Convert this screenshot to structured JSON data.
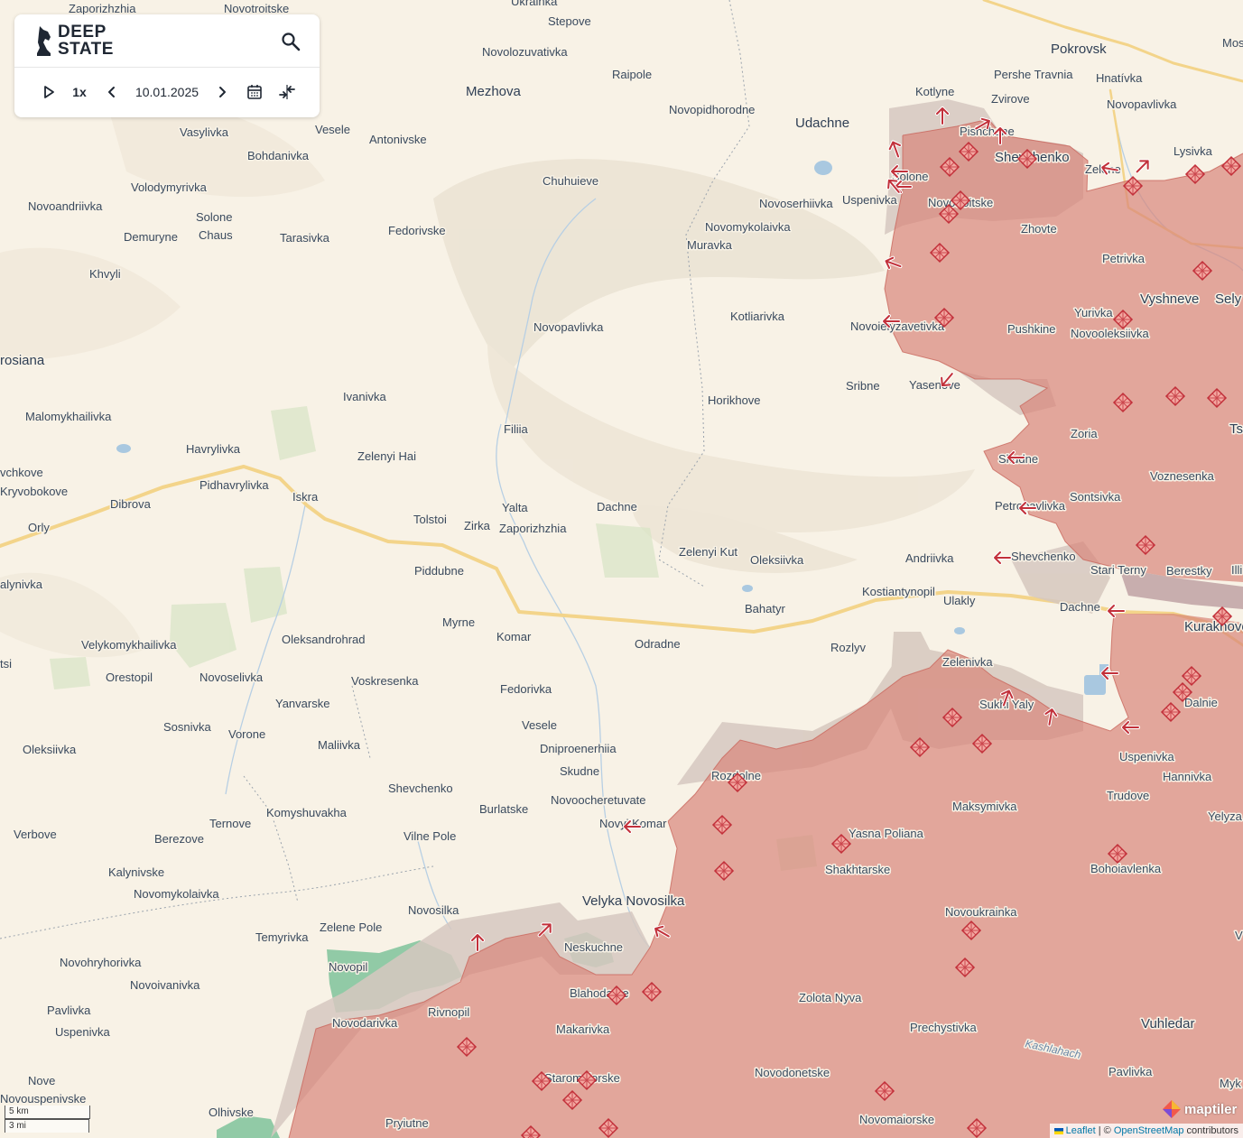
{
  "app": {
    "logo_line1": "DEEP",
    "logo_line2": "STATE",
    "search_icon": "search-icon",
    "play_icon": "play-icon",
    "speed": "1x",
    "date": "10.01.2025",
    "calendar_icon": "calendar-icon",
    "compare_icon": "compare-icon"
  },
  "scale": {
    "km": "5 km",
    "mi": "3 mi"
  },
  "attribution": {
    "leaflet": "Leaflet",
    "separator": " | © ",
    "osm": "OpenStreetMap",
    "suffix": " contributors",
    "maptiler": "maptiler"
  },
  "colors": {
    "occupied": "#d9867a",
    "occupied_opacity": 0.7,
    "contested": "#d6c8bf",
    "liberated": "#7fc39a",
    "background": "#f8f2e6",
    "road": "#f3d48a",
    "marker": "#c2303a"
  },
  "places": [
    {
      "name": "Zaporizhzhia"
    },
    {
      "name": "Novotroitske"
    },
    {
      "name": "Ukrainka"
    },
    {
      "name": "Stepove"
    },
    {
      "name": "Novolozuvativka"
    },
    {
      "name": "Raipole"
    },
    {
      "name": "Mezhova"
    },
    {
      "name": "Novopidhorodne"
    },
    {
      "name": "Udachne"
    },
    {
      "name": "Kotlyne"
    },
    {
      "name": "Pokrovsk"
    },
    {
      "name": "Pershe Travnia"
    },
    {
      "name": "Hnatívka"
    },
    {
      "name": "Zvirove"
    },
    {
      "name": "Novopavlivka"
    },
    {
      "name": "Mos"
    },
    {
      "name": "Pishchane"
    },
    {
      "name": "Shevchenko"
    },
    {
      "name": "Zelene"
    },
    {
      "name": "Lysivka"
    },
    {
      "name": "Solone"
    },
    {
      "name": "Uspenivka"
    },
    {
      "name": "Novotroitske"
    },
    {
      "name": "Zhovte"
    },
    {
      "name": "Petrivka"
    },
    {
      "name": "Vyshneve"
    },
    {
      "name": "Sely"
    },
    {
      "name": "Yurivka"
    },
    {
      "name": "Novooleksiivka"
    },
    {
      "name": "Pushkine"
    },
    {
      "name": "Vasylivka"
    },
    {
      "name": "Vesele"
    },
    {
      "name": "Antonivske"
    },
    {
      "name": "Bohdanivka"
    },
    {
      "name": "Volodymyrivka"
    },
    {
      "name": "Novoandriivka"
    },
    {
      "name": "Solone"
    },
    {
      "name": "Chaus"
    },
    {
      "name": "Demuryne"
    },
    {
      "name": "Tarasivka"
    },
    {
      "name": "Fedorivske"
    },
    {
      "name": "Chuhuieve"
    },
    {
      "name": "Novoserhiivka"
    },
    {
      "name": "Novomykolaivka"
    },
    {
      "name": "Muravka"
    },
    {
      "name": "Khvyli"
    },
    {
      "name": "rosiana"
    },
    {
      "name": "Novopavlivka"
    },
    {
      "name": "Kotliarivka"
    },
    {
      "name": "Novoielyzavetivka"
    },
    {
      "name": "Sribne"
    },
    {
      "name": "Yasenove"
    },
    {
      "name": "Ivanivka"
    },
    {
      "name": "Horikhove"
    },
    {
      "name": "Malomykhailivka"
    },
    {
      "name": "Filiia"
    },
    {
      "name": "Havrylivka"
    },
    {
      "name": "Zelenyi Hai"
    },
    {
      "name": "Zoria"
    },
    {
      "name": "Ts"
    },
    {
      "name": "Skudne"
    },
    {
      "name": "Voznesenka"
    },
    {
      "name": "vchkove"
    },
    {
      "name": "Kryvobokove"
    },
    {
      "name": "Pidhavrylivka"
    },
    {
      "name": "Iskra"
    },
    {
      "name": "Dibrova"
    },
    {
      "name": "Yalta"
    },
    {
      "name": "Dachne"
    },
    {
      "name": "Sontsivka"
    },
    {
      "name": "Petropavlivka"
    },
    {
      "name": "Orly"
    },
    {
      "name": "Tolstoi"
    },
    {
      "name": "Zirka"
    },
    {
      "name": "Zaporizhzhia"
    },
    {
      "name": "Zelenyi Kut"
    },
    {
      "name": "Oleksiivka"
    },
    {
      "name": "Andriivka"
    },
    {
      "name": "Shevchenko"
    },
    {
      "name": "Stari Terny"
    },
    {
      "name": "Berestky"
    },
    {
      "name": "Illi"
    },
    {
      "name": "Piddubne"
    },
    {
      "name": "Kostiantynopil"
    },
    {
      "name": "Ulakly"
    },
    {
      "name": "Dachne"
    },
    {
      "name": "alynivka"
    },
    {
      "name": "Bahatyr"
    },
    {
      "name": "Kurakhove"
    },
    {
      "name": "Myrne"
    },
    {
      "name": "Komar"
    },
    {
      "name": "Odradne"
    },
    {
      "name": "Rozlyv"
    },
    {
      "name": "Velykomykhailivka"
    },
    {
      "name": "Oleksandrohrad"
    },
    {
      "name": "Zelenivka"
    },
    {
      "name": "tsi"
    },
    {
      "name": "Orestopil"
    },
    {
      "name": "Novoselivka"
    },
    {
      "name": "Voskresenka"
    },
    {
      "name": "Fedorivka"
    },
    {
      "name": "Sukhi Yaly"
    },
    {
      "name": "Dalnie"
    },
    {
      "name": "Yanvarske"
    },
    {
      "name": "Sosnivka"
    },
    {
      "name": "Vorone"
    },
    {
      "name": "Vesele"
    },
    {
      "name": "Maliivka"
    },
    {
      "name": "Dniproenerhiia"
    },
    {
      "name": "Oleksiivka"
    },
    {
      "name": "Uspenivka"
    },
    {
      "name": "Hannivka"
    },
    {
      "name": "Skudne"
    },
    {
      "name": "Rozdolne"
    },
    {
      "name": "Shevchenko"
    },
    {
      "name": "Novoocheretuvate"
    },
    {
      "name": "Maksymivka"
    },
    {
      "name": "Trudove"
    },
    {
      "name": "Komyshuvakha"
    },
    {
      "name": "Burlatske"
    },
    {
      "name": "Yelyza"
    },
    {
      "name": "Ternove"
    },
    {
      "name": "Verbove"
    },
    {
      "name": "Novyi Komar"
    },
    {
      "name": "Yasna Poliana"
    },
    {
      "name": "Berezove"
    },
    {
      "name": "Vilne Pole"
    },
    {
      "name": "Shakhtarske"
    },
    {
      "name": "Bohoiavlenka"
    },
    {
      "name": "Kalynivske"
    },
    {
      "name": "Novomykolaivka"
    },
    {
      "name": "Velyka Novosilka"
    },
    {
      "name": "Novosilka"
    },
    {
      "name": "Novoukrainka"
    },
    {
      "name": "Zelene Pole"
    },
    {
      "name": "Temyrivka"
    },
    {
      "name": "Neskuchne"
    },
    {
      "name": "Novohryhorivka"
    },
    {
      "name": "Novopil"
    },
    {
      "name": "Novoivanivka"
    },
    {
      "name": "Blahodatne"
    },
    {
      "name": "Zolota Nyva"
    },
    {
      "name": "Pavlivka"
    },
    {
      "name": "Rivnopil"
    },
    {
      "name": "Uspenivka"
    },
    {
      "name": "Novodarivka"
    },
    {
      "name": "Makarivka"
    },
    {
      "name": "Prechystivka"
    },
    {
      "name": "Vuhledar"
    },
    {
      "name": "Kashlahach"
    },
    {
      "name": "Nove"
    },
    {
      "name": "Staromaiorske"
    },
    {
      "name": "Novodonetske"
    },
    {
      "name": "Pavlivka"
    },
    {
      "name": "Novouspenivske"
    },
    {
      "name": "Myk"
    },
    {
      "name": "Olhivske"
    },
    {
      "name": "Pryiutne"
    },
    {
      "name": "Novomaiorske"
    },
    {
      "name": "V"
    }
  ]
}
